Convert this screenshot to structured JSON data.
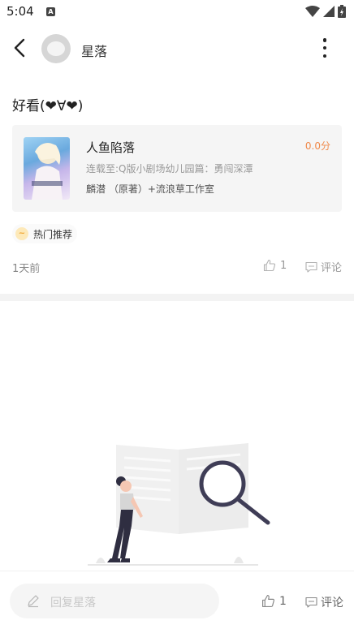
{
  "status_bar": {
    "time": "5:04",
    "notification_icon": "a-icon",
    "icons": [
      "wifi-icon",
      "signal-icon",
      "battery-icon"
    ]
  },
  "header": {
    "user_name": "星落",
    "back_icon": "chevron-left-icon",
    "more_icon": "more-vertical-icon"
  },
  "post": {
    "text": "好看(❤∀❤)",
    "book": {
      "title": "人鱼陷落",
      "score": "0.0分",
      "progress": "连载至:Q版小剧场幼儿园篇：勇闯深潭",
      "authors": "麟潜 （原著）+流浪草工作室"
    },
    "tag": {
      "icon": "trend-icon",
      "label": "热门推荐"
    },
    "time_ago": "1天前",
    "likes": "1",
    "comment_label": "评论"
  },
  "bottom_bar": {
    "reply_placeholder": "回复星落",
    "likes": "1",
    "comment_label": "评论"
  },
  "colors": {
    "accent_orange": "#f08a4b",
    "illustration_dark": "#2f2e41",
    "muted_text": "#999999"
  }
}
